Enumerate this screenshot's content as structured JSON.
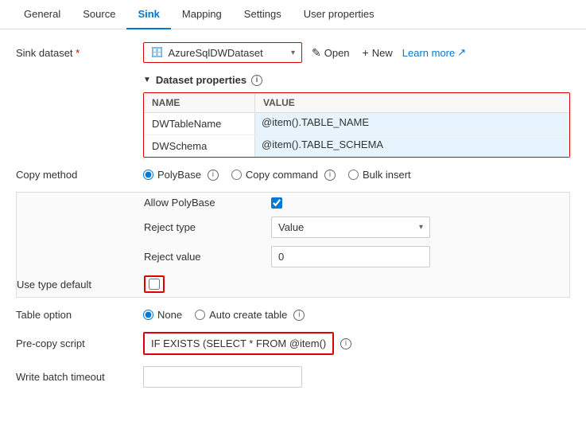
{
  "tabs": [
    {
      "id": "general",
      "label": "General",
      "active": false
    },
    {
      "id": "source",
      "label": "Source",
      "active": false
    },
    {
      "id": "sink",
      "label": "Sink",
      "active": true
    },
    {
      "id": "mapping",
      "label": "Mapping",
      "active": false
    },
    {
      "id": "settings",
      "label": "Settings",
      "active": false
    },
    {
      "id": "user-properties",
      "label": "User properties",
      "active": false
    }
  ],
  "sink_dataset": {
    "label": "Sink dataset",
    "required": true,
    "value": "AzureSqlDWDataset",
    "open_label": "Open",
    "new_label": "New",
    "learn_more_label": "Learn more"
  },
  "dataset_properties": {
    "title": "Dataset properties",
    "columns": {
      "name": "NAME",
      "value": "VALUE"
    },
    "rows": [
      {
        "name": "DWTableName",
        "value": "@item().TABLE_NAME"
      },
      {
        "name": "DWSchema",
        "value": "@item().TABLE_SCHEMA"
      }
    ]
  },
  "copy_method": {
    "label": "Copy method",
    "options": [
      {
        "id": "polybase",
        "label": "PolyBase",
        "checked": true
      },
      {
        "id": "copy-command",
        "label": "Copy command",
        "checked": false
      },
      {
        "id": "bulk-insert",
        "label": "Bulk insert",
        "checked": false
      }
    ]
  },
  "allow_polybase": {
    "label": "Allow PolyBase",
    "checked": true
  },
  "reject_type": {
    "label": "Reject type",
    "value": "Value"
  },
  "reject_value": {
    "label": "Reject value",
    "value": "0"
  },
  "use_type_default": {
    "label": "Use type default"
  },
  "table_option": {
    "label": "Table option",
    "options": [
      {
        "id": "none",
        "label": "None",
        "checked": true
      },
      {
        "id": "auto-create",
        "label": "Auto create table",
        "checked": false
      }
    ]
  },
  "pre_copy_script": {
    "label": "Pre-copy script",
    "value": "IF EXISTS (SELECT * FROM @item().TA..."
  },
  "write_batch_timeout": {
    "label": "Write batch timeout",
    "value": ""
  },
  "icons": {
    "info": "ⓘ",
    "collapse": "▶",
    "pencil": "✎",
    "plus": "+",
    "external": "↗",
    "chevron_down": "⌄",
    "database": "🗄"
  }
}
